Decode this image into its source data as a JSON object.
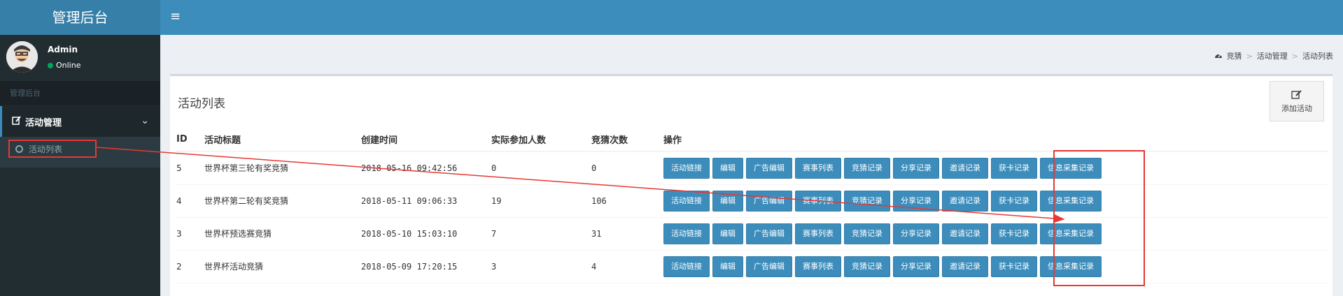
{
  "header": {
    "title": "管理后台",
    "menu_toggle": "≡"
  },
  "user": {
    "name": "Admin",
    "status": "Online"
  },
  "sidebar": {
    "header": "管理后台",
    "menu": {
      "label": "活动管理"
    },
    "sub_items": [
      {
        "label": "活动列表"
      }
    ]
  },
  "breadcrumb": [
    "竞猜",
    "活动管理",
    "活动列表"
  ],
  "box": {
    "title": "活动列表",
    "add_label": "添加活动"
  },
  "table": {
    "headers": [
      "ID",
      "活动标题",
      "创建时间",
      "实际参加人数",
      "竞猜次数",
      "操作"
    ],
    "rows": [
      {
        "id": "5",
        "title": "世界杯第三轮有奖竞猜",
        "created": "2018-05-16 09:42:56",
        "participants": "0",
        "guesses": "0"
      },
      {
        "id": "4",
        "title": "世界杯第二轮有奖竞猜",
        "created": "2018-05-11 09:06:33",
        "participants": "19",
        "guesses": "106"
      },
      {
        "id": "3",
        "title": "世界杯预选赛竞猜",
        "created": "2018-05-10 15:03:10",
        "participants": "7",
        "guesses": "31"
      },
      {
        "id": "2",
        "title": "世界杯活动竞猜",
        "created": "2018-05-09 17:20:15",
        "participants": "3",
        "guesses": "4"
      }
    ],
    "actions": [
      "活动链接",
      "编辑",
      "广告编辑",
      "赛事列表",
      "竞猜记录",
      "分享记录",
      "邀请记录",
      "获卡记录",
      "信息采集记录"
    ]
  },
  "colors": {
    "header": "#3c8dbc",
    "logo": "#367fa9",
    "sidebar": "#222d32",
    "button": "#3c8dbc",
    "annotation": "#e53935"
  }
}
